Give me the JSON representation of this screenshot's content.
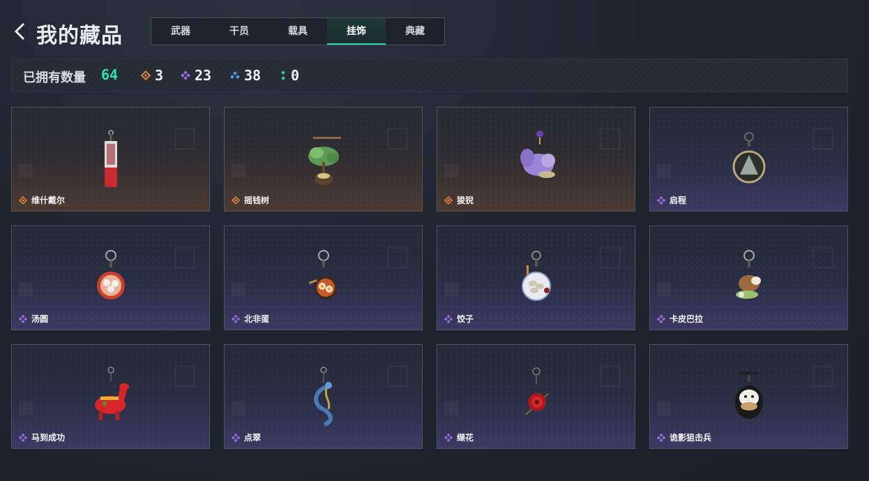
{
  "header": {
    "title": "我的藏品"
  },
  "tabs": [
    {
      "label": "武器",
      "active": false
    },
    {
      "label": "干员",
      "active": false
    },
    {
      "label": "载具",
      "active": false
    },
    {
      "label": "挂饰",
      "active": true
    },
    {
      "label": "典藏",
      "active": false
    }
  ],
  "stats": {
    "owned_label": "已拥有数量",
    "owned_count": "64",
    "rarities": [
      {
        "icon": "gold-diamond-icon",
        "color": "#e0813a",
        "count": "3"
      },
      {
        "icon": "purple-diamond-icon",
        "color": "#9a6ae0",
        "count": "23"
      },
      {
        "icon": "blue-diamond-icon",
        "color": "#4aa3e8",
        "count": "38"
      },
      {
        "icon": "green-diamond-icon",
        "color": "#2ed39a",
        "count": "0"
      }
    ]
  },
  "colors": {
    "accent": "#27d6a0",
    "gold": "#e0813a",
    "purple": "#9a6ae0"
  },
  "items": [
    {
      "name": "维什戴尔",
      "rarity": "gold",
      "icon": "nameplate-charm-icon"
    },
    {
      "name": "摇钱树",
      "rarity": "gold",
      "icon": "money-tree-charm-icon"
    },
    {
      "name": "狻猊",
      "rarity": "gold",
      "icon": "suanni-charm-icon"
    },
    {
      "name": "启程",
      "rarity": "purple",
      "icon": "medal-charm-icon"
    },
    {
      "name": "汤圆",
      "rarity": "purple",
      "icon": "tangyuan-charm-icon"
    },
    {
      "name": "北非蛋",
      "rarity": "purple",
      "icon": "shakshuka-charm-icon"
    },
    {
      "name": "饺子",
      "rarity": "purple",
      "icon": "dumpling-charm-icon"
    },
    {
      "name": "卡皮巴拉",
      "rarity": "purple",
      "icon": "capybara-charm-icon"
    },
    {
      "name": "马到成功",
      "rarity": "purple",
      "icon": "horse-charm-icon"
    },
    {
      "name": "点翠",
      "rarity": "purple",
      "icon": "phoenix-charm-icon"
    },
    {
      "name": "缬花",
      "rarity": "purple",
      "icon": "rose-charm-icon"
    },
    {
      "name": "诡影狙击兵",
      "rarity": "purple",
      "icon": "sniper-charm-icon"
    }
  ]
}
